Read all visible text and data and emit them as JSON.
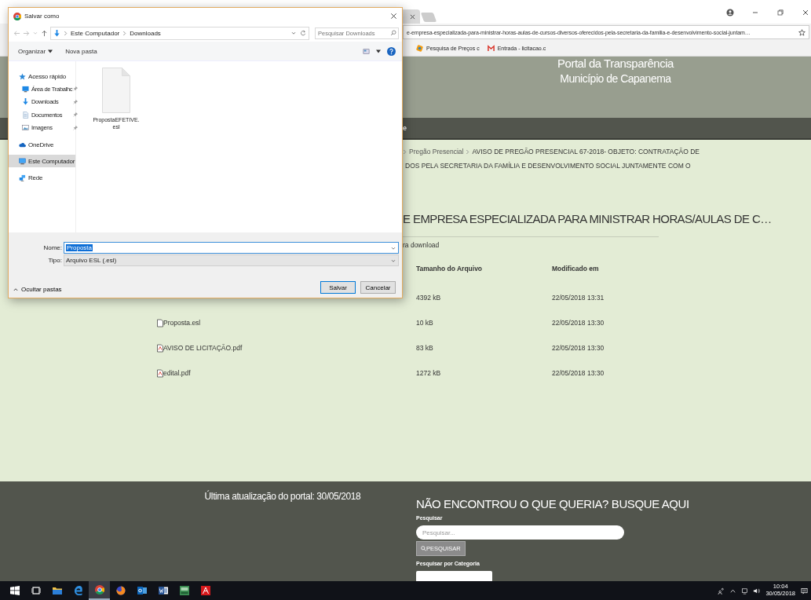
{
  "browser": {
    "address": "e-empresa-especializada-para-ministrar-horas-aulas-de-cursos-diversos-oferecidos-pela-secretaria-da-familia-e-desenvolvimento-social-juntam…",
    "bookmarks": [
      {
        "label": "Pesquisa de Preços c",
        "kind": "app"
      },
      {
        "label": "Entrada - licitacao.c",
        "kind": "mail"
      }
    ]
  },
  "site": {
    "title": "Portal da Transparência",
    "subtitle": "Município de Capanema",
    "nav_fragment": "e",
    "breadcrumb": {
      "link": "Pregão Presencial",
      "current_lines": [
        "AVISO DE PREGÃO PRESENCIAL 67-2018- OBJETO: CONTRATAÇÃO DE",
        "DOS PELA SECRETARIA DA FAMÍLIA E DESENVOLVIMENTO SOCIAL JUNTAMENTE COM O"
      ]
    },
    "heading": "E EMPRESA ESPECIALIZADA PARA MINISTRAR HORAS/AULAS DE C…",
    "downloads_label": "ra download",
    "columns": [
      "Tamanho do Arquivo",
      "Modificado em"
    ],
    "files": [
      {
        "size": "4392 kB",
        "modified": "22/05/2018 13:31"
      },
      {
        "kind": "file",
        "name": "Proposta.esl",
        "size": "10 kB",
        "modified": "22/05/2018 13:30"
      },
      {
        "kind": "pdf",
        "name": "AVISO DE LICITAÇÃO.pdf",
        "size": "83 kB",
        "modified": "22/05/2018 13:30"
      },
      {
        "kind": "pdf",
        "name": "edital.pdf",
        "size": "1272 kB",
        "modified": "22/05/2018 13:30"
      }
    ],
    "footer": {
      "updated": "Última atualização do portal: 30/05/2018",
      "search_heading": "NÃO ENCONTROU O QUE QUERIA? BUSQUE AQUI",
      "search_label": "Pesquisar",
      "search_placeholder": "Pesquisar...",
      "search_button": "PESQUISAR",
      "category_label": "Pesquisar por Categoria"
    }
  },
  "dialog": {
    "title": "Salvar como",
    "path": [
      "Este Computador",
      "Downloads"
    ],
    "search_placeholder": "Pesquisar Downloads",
    "toolbar": [
      "Organizar",
      "Nova pasta"
    ],
    "nav": [
      {
        "label": "Acesso rápido",
        "kind": "star",
        "selected": false,
        "children": [
          {
            "label": "Área de Trabalhc",
            "kind": "desktop",
            "pinned": true,
            "selected": false
          },
          {
            "label": "Downloads",
            "kind": "download",
            "pinned": true,
            "selected": false
          },
          {
            "label": "Documentos",
            "kind": "document",
            "pinned": true,
            "selected": false
          },
          {
            "label": "Imagens",
            "kind": "image",
            "pinned": true,
            "selected": false
          }
        ]
      },
      {
        "label": "OneDrive",
        "kind": "cloud",
        "selected": false
      },
      {
        "label": "Este Computador",
        "kind": "computer",
        "selected": true
      },
      {
        "label": "Rede",
        "kind": "network",
        "selected": false
      }
    ],
    "files": [
      {
        "name": "PropostaEFETIVE.esl",
        "selected": false
      }
    ],
    "name_label": "Nome:",
    "name_value": "Proposta",
    "type_label": "Tipo:",
    "type_value": "Arquivo ESL (.esl)",
    "hide_folders": "Ocultar pastas",
    "save": "Salvar",
    "cancel": "Cancelar"
  },
  "taskbar": {
    "apps": [
      {
        "kind": "start",
        "active": false
      },
      {
        "kind": "taskview",
        "active": false
      },
      {
        "kind": "explorer",
        "active": false
      },
      {
        "kind": "edge",
        "active": false
      },
      {
        "kind": "chrome",
        "active": true
      },
      {
        "kind": "firefox",
        "active": false
      },
      {
        "kind": "outlook",
        "active": false
      },
      {
        "kind": "word",
        "active": false
      },
      {
        "kind": "scp",
        "active": false
      },
      {
        "kind": "acrobat",
        "active": false
      }
    ],
    "time": "10:04",
    "date": "30/05/2018"
  }
}
